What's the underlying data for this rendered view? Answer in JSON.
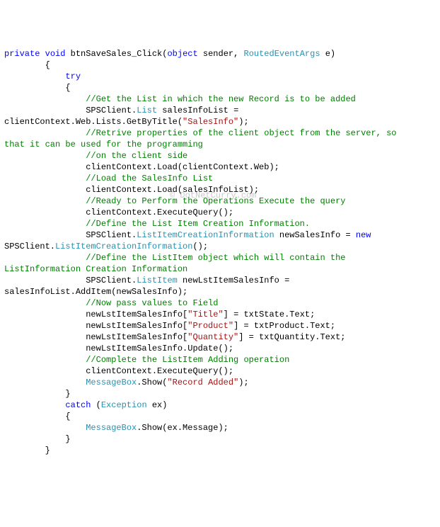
{
  "watermark": "© DotNetCurry.com",
  "lines": [
    {
      "indent": 0,
      "runs": [
        {
          "cls": "kw",
          "t": "private"
        },
        {
          "t": " "
        },
        {
          "cls": "kw",
          "t": "void"
        },
        {
          "t": " btnSaveSales_Click("
        },
        {
          "cls": "kw",
          "t": "object"
        },
        {
          "t": " sender, "
        },
        {
          "cls": "typ",
          "t": "RoutedEventArgs"
        },
        {
          "t": " e)"
        }
      ]
    },
    {
      "indent": 8,
      "runs": [
        {
          "t": "{"
        }
      ]
    },
    {
      "indent": 12,
      "runs": [
        {
          "cls": "kw",
          "t": "try"
        }
      ]
    },
    {
      "indent": 12,
      "runs": [
        {
          "t": "{"
        }
      ]
    },
    {
      "indent": 0,
      "runs": [
        {
          "t": ""
        }
      ]
    },
    {
      "indent": 16,
      "runs": [
        {
          "cls": "cmt",
          "t": "//Get the List in which the new Record is to be added"
        }
      ]
    },
    {
      "indent": 16,
      "runs": [
        {
          "t": "SPSClient."
        },
        {
          "cls": "typ",
          "t": "List"
        },
        {
          "t": " salesInfoList = "
        }
      ]
    },
    {
      "indent": 0,
      "runs": [
        {
          "t": "clientContext.Web.Lists.GetByTitle("
        },
        {
          "cls": "str",
          "t": "\"SalesInfo\""
        },
        {
          "t": ");"
        }
      ]
    },
    {
      "indent": 16,
      "runs": [
        {
          "cls": "cmt",
          "t": "//Retrive properties of the client object from the server, so "
        }
      ]
    },
    {
      "indent": 0,
      "runs": [
        {
          "cls": "cmt",
          "t": "that it can be used for the programming"
        }
      ]
    },
    {
      "indent": 16,
      "runs": [
        {
          "cls": "cmt",
          "t": "//on the client side"
        }
      ]
    },
    {
      "indent": 16,
      "runs": [
        {
          "t": "clientContext.Load(clientContext.Web);"
        }
      ]
    },
    {
      "indent": 16,
      "runs": [
        {
          "cls": "cmt",
          "t": "//Load the SalesInfo List"
        }
      ]
    },
    {
      "indent": 16,
      "runs": [
        {
          "t": "clientContext.Load(salesInfoList);"
        }
      ]
    },
    {
      "indent": 16,
      "runs": [
        {
          "cls": "cmt",
          "t": "//Ready to Perform the Operations Execute the query"
        }
      ]
    },
    {
      "indent": 16,
      "runs": [
        {
          "t": "clientContext.ExecuteQuery();"
        }
      ]
    },
    {
      "indent": 16,
      "runs": [
        {
          "cls": "cmt",
          "t": "//Define the List Item Creation Information."
        }
      ]
    },
    {
      "indent": 16,
      "runs": [
        {
          "t": "SPSClient."
        },
        {
          "cls": "typ",
          "t": "ListItemCreationInformation"
        },
        {
          "t": " newSalesInfo = "
        },
        {
          "cls": "kw",
          "t": "new"
        },
        {
          "t": " "
        }
      ]
    },
    {
      "indent": 0,
      "runs": [
        {
          "t": "SPSClient."
        },
        {
          "cls": "typ",
          "t": "ListItemCreationInformation"
        },
        {
          "t": "();"
        }
      ]
    },
    {
      "indent": 16,
      "runs": [
        {
          "cls": "cmt",
          "t": "//Define the ListItem object which will contain the "
        }
      ]
    },
    {
      "indent": 0,
      "runs": [
        {
          "cls": "cmt",
          "t": "ListInformation Creation Information"
        }
      ]
    },
    {
      "indent": 16,
      "runs": [
        {
          "t": "SPSClient."
        },
        {
          "cls": "typ",
          "t": "ListItem"
        },
        {
          "t": " newLstItemSalesInfo = "
        }
      ]
    },
    {
      "indent": 0,
      "runs": [
        {
          "t": "salesInfoList.AddItem(newSalesInfo);"
        }
      ]
    },
    {
      "indent": 16,
      "runs": [
        {
          "cls": "cmt",
          "t": "//Now pass values to Field"
        }
      ]
    },
    {
      "indent": 16,
      "runs": [
        {
          "t": "newLstItemSalesInfo["
        },
        {
          "cls": "str",
          "t": "\"Title\""
        },
        {
          "t": "] = txtState.Text;"
        }
      ]
    },
    {
      "indent": 16,
      "runs": [
        {
          "t": "newLstItemSalesInfo["
        },
        {
          "cls": "str",
          "t": "\"Product\""
        },
        {
          "t": "] = txtProduct.Text;"
        }
      ]
    },
    {
      "indent": 16,
      "runs": [
        {
          "t": "newLstItemSalesInfo["
        },
        {
          "cls": "str",
          "t": "\"Quantity\""
        },
        {
          "t": "] = txtQuantity.Text;"
        }
      ]
    },
    {
      "indent": 16,
      "runs": [
        {
          "t": "newLstItemSalesInfo.Update();"
        }
      ]
    },
    {
      "indent": 0,
      "runs": [
        {
          "t": ""
        }
      ]
    },
    {
      "indent": 16,
      "runs": [
        {
          "cls": "cmt",
          "t": "//Complete the ListItem Adding operation"
        }
      ]
    },
    {
      "indent": 16,
      "runs": [
        {
          "t": "clientContext.ExecuteQuery();"
        }
      ]
    },
    {
      "indent": 16,
      "runs": [
        {
          "cls": "typ",
          "t": "MessageBox"
        },
        {
          "t": ".Show("
        },
        {
          "cls": "str",
          "t": "\"Record Added\""
        },
        {
          "t": ");"
        }
      ]
    },
    {
      "indent": 12,
      "runs": [
        {
          "t": "}"
        }
      ]
    },
    {
      "indent": 0,
      "runs": [
        {
          "t": ""
        }
      ]
    },
    {
      "indent": 12,
      "runs": [
        {
          "cls": "kw",
          "t": "catch"
        },
        {
          "t": " ("
        },
        {
          "cls": "typ",
          "t": "Exception"
        },
        {
          "t": " ex)"
        }
      ]
    },
    {
      "indent": 12,
      "runs": [
        {
          "t": "{"
        }
      ]
    },
    {
      "indent": 16,
      "runs": [
        {
          "cls": "typ",
          "t": "MessageBox"
        },
        {
          "t": ".Show(ex.Message);"
        }
      ]
    },
    {
      "indent": 12,
      "runs": [
        {
          "t": "}"
        }
      ]
    },
    {
      "indent": 8,
      "runs": [
        {
          "t": "}"
        }
      ]
    }
  ]
}
